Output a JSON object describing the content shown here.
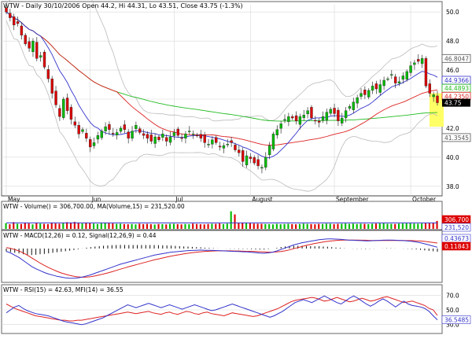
{
  "header": {
    "symbol": "WTW",
    "info": "WTW - Daily 30/10/2006 Open 44.2, Hi 44.31, Lo 43.51, Close 43.75 (-1.3%)"
  },
  "colors": {
    "up": "#00bb00",
    "down": "#dd0000",
    "ma_short": "#3333cc",
    "ma_mid": "#dd2222",
    "ma_long": "#22bb22",
    "bands": "#bbbbbb",
    "grid": "#d8d8d8",
    "highlight": "#ffff66"
  },
  "chart_data": [
    {
      "type": "candlestick",
      "panel": "price",
      "title": "WTW - Daily 30/10/2006 Open 44.2, Hi 44.31, Lo 43.51, Close 43.75 (-1.3%)",
      "y_ticks": [
        38.0,
        40.0,
        42.0,
        44.0,
        46.0,
        48.0,
        50.0
      ],
      "ylim": [
        37.5,
        50.5
      ],
      "x_labels": [
        "May",
        "Jun",
        "Jul",
        "August",
        "September",
        "October"
      ],
      "x_label_index": [
        0,
        22,
        44,
        64,
        86,
        106
      ],
      "closes": [
        50.0,
        49.6,
        49.1,
        49.2,
        48.4,
        47.8,
        47.5,
        48.0,
        46.8,
        47.0,
        46.2,
        45.4,
        44.4,
        43.6,
        42.8,
        44.0,
        43.2,
        42.6,
        42.2,
        41.6,
        41.9,
        41.3,
        40.7,
        41.0,
        41.5,
        41.8,
        42.1,
        41.9,
        41.6,
        41.7,
        42.0,
        41.9,
        41.3,
        41.8,
        42.2,
        41.7,
        41.5,
        41.3,
        41.1,
        41.4,
        41.2,
        41.6,
        41.1,
        41.4,
        41.7,
        41.5,
        41.3,
        41.6,
        41.8,
        41.6,
        41.5,
        41.3,
        41.0,
        40.9,
        41.2,
        41.0,
        40.7,
        40.8,
        40.9,
        41.0,
        40.5,
        40.3,
        39.7,
        40.1,
        39.9,
        39.6,
        39.4,
        39.3,
        40.0,
        40.8,
        41.6,
        41.9,
        42.3,
        42.6,
        42.8,
        42.7,
        42.5,
        42.8,
        42.9,
        43.2,
        42.7,
        42.5,
        42.4,
        42.8,
        43.1,
        43.3,
        43.0,
        42.5,
        42.7,
        43.2,
        43.5,
        43.8,
        44.1,
        44.4,
        44.3,
        44.6,
        44.9,
        44.7,
        45.0,
        45.3,
        45.4,
        45.7,
        45.1,
        45.2,
        45.6,
        45.9,
        46.3,
        46.5,
        46.6,
        46.8,
        44.9,
        44.4,
        44.3,
        43.75
      ],
      "last_close": "43.75",
      "sma_labels": [
        "46.8047",
        "44.9366",
        "44.4893",
        "44.2350",
        "41.3545"
      ],
      "sma_colors": [
        "#555555",
        "#3333cc",
        "#22bb22",
        "#dd2222",
        "#555555"
      ]
    },
    {
      "type": "bar",
      "panel": "volume",
      "label": "WTW - Volume() = 306,700.00, MA(Volume,15) = 231,520.00",
      "value_labels": [
        "306,700",
        "231,520"
      ],
      "volumes": [
        220,
        180,
        260,
        200,
        190,
        230,
        210,
        175,
        240,
        205,
        195,
        185,
        230,
        210,
        200,
        225,
        260,
        245,
        270,
        230,
        210,
        240,
        220,
        205,
        190,
        215,
        240,
        225,
        210,
        195,
        200,
        185,
        180,
        190,
        175,
        200,
        185,
        195,
        180,
        170,
        190,
        185,
        175,
        195,
        200,
        185,
        175,
        190,
        180,
        205,
        190,
        180,
        175,
        190,
        200,
        195,
        210,
        185,
        205,
        680,
        560,
        240,
        235,
        225,
        215,
        205,
        200,
        195,
        190,
        185,
        175,
        195,
        180,
        190,
        200,
        185,
        180,
        190,
        205,
        195,
        185,
        180,
        195,
        190,
        205,
        200,
        185,
        195,
        200,
        210,
        195,
        205,
        190,
        200,
        195,
        185,
        200,
        205,
        210,
        215,
        200,
        195,
        190,
        205,
        210,
        215,
        220,
        205,
        200,
        210,
        215,
        225,
        240,
        306.7
      ],
      "volume_ma": 231.52
    },
    {
      "type": "line",
      "panel": "macd",
      "label": "WTW - MACD(12,26) = 0.12, Signal(12,26,9) = 0.44",
      "value_labels": [
        "0.43673",
        "0.11843"
      ],
      "series": [
        {
          "name": "MACD(12,26)",
          "color": "#3333cc"
        },
        {
          "name": "Signal(12,26,9)",
          "color": "#dd2222"
        }
      ],
      "macd": [
        -0.1,
        -0.18,
        -0.3,
        -0.42,
        -0.58,
        -0.74,
        -0.9,
        -1.02,
        -1.12,
        -1.22,
        -1.3,
        -1.36,
        -1.42,
        -1.46,
        -1.5,
        -1.52,
        -1.52,
        -1.5,
        -1.46,
        -1.4,
        -1.34,
        -1.26,
        -1.18,
        -1.1,
        -1.02,
        -0.94,
        -0.86,
        -0.78,
        -0.72,
        -0.66,
        -0.6,
        -0.54,
        -0.48,
        -0.42,
        -0.36,
        -0.3,
        -0.26,
        -0.22,
        -0.18,
        -0.14,
        -0.12,
        -0.1,
        -0.08,
        -0.06,
        -0.05,
        -0.04,
        -0.03,
        -0.04,
        -0.04,
        -0.05,
        -0.06,
        -0.07,
        -0.08,
        -0.09,
        -0.1,
        -0.11,
        -0.12,
        -0.13,
        -0.15,
        -0.17,
        -0.19,
        -0.2,
        -0.18,
        -0.14,
        -0.08,
        0.0,
        0.08,
        0.16,
        0.24,
        0.3,
        0.36,
        0.4,
        0.44,
        0.48,
        0.52,
        0.54,
        0.56,
        0.56,
        0.55,
        0.54,
        0.52,
        0.5,
        0.49,
        0.48,
        0.47,
        0.46,
        0.46,
        0.47,
        0.48,
        0.49,
        0.5,
        0.5,
        0.49,
        0.48,
        0.47,
        0.45,
        0.43,
        0.4,
        0.36,
        0.3,
        0.24,
        0.18,
        0.12
      ],
      "signal": [
        0.1,
        0.06,
        0.0,
        -0.08,
        -0.18,
        -0.3,
        -0.44,
        -0.58,
        -0.72,
        -0.84,
        -0.96,
        -1.06,
        -1.16,
        -1.24,
        -1.31,
        -1.37,
        -1.42,
        -1.45,
        -1.47,
        -1.46,
        -1.44,
        -1.4,
        -1.35,
        -1.3,
        -1.24,
        -1.18,
        -1.11,
        -1.04,
        -0.98,
        -0.91,
        -0.85,
        -0.79,
        -0.73,
        -0.67,
        -0.61,
        -0.55,
        -0.5,
        -0.45,
        -0.4,
        -0.35,
        -0.31,
        -0.27,
        -0.23,
        -0.2,
        -0.17,
        -0.14,
        -0.12,
        -0.1,
        -0.09,
        -0.08,
        -0.07,
        -0.07,
        -0.07,
        -0.07,
        -0.08,
        -0.08,
        -0.09,
        -0.1,
        -0.1,
        -0.11,
        -0.12,
        -0.13,
        -0.14,
        -0.14,
        -0.13,
        -0.11,
        -0.07,
        -0.02,
        0.04,
        0.1,
        0.16,
        0.22,
        0.27,
        0.32,
        0.36,
        0.4,
        0.43,
        0.46,
        0.48,
        0.49,
        0.5,
        0.5,
        0.5,
        0.5,
        0.49,
        0.49,
        0.48,
        0.48,
        0.48,
        0.48,
        0.48,
        0.48,
        0.48,
        0.48,
        0.48,
        0.47,
        0.47,
        0.46,
        0.45,
        0.43,
        0.4,
        0.37,
        0.34
      ]
    },
    {
      "type": "line",
      "panel": "rsi",
      "label": "WTW - RSI(15) = 42.63, MFI(14) = 36.55",
      "y_ticks": [
        30.0,
        50.0,
        70.0
      ],
      "ylim": [
        20,
        80
      ],
      "value_labels": [
        "36.5485"
      ],
      "series": [
        {
          "name": "RSI(15)",
          "color": "#dd2222"
        },
        {
          "name": "MFI(14)",
          "color": "#3333cc"
        }
      ],
      "rsi": [
        58,
        55,
        52,
        50,
        48,
        46,
        44,
        42,
        41,
        40,
        39,
        38,
        37,
        36,
        36,
        35,
        35,
        36,
        36,
        37,
        38,
        39,
        40,
        41,
        42,
        43,
        44,
        45,
        46,
        47,
        46,
        45,
        46,
        47,
        48,
        46,
        45,
        44,
        46,
        47,
        45,
        44,
        46,
        48,
        47,
        45,
        44,
        46,
        47,
        45,
        44,
        43,
        42,
        44,
        46,
        45,
        44,
        43,
        42,
        41,
        42,
        44,
        46,
        48,
        50,
        52,
        55,
        58,
        61,
        63,
        64,
        65,
        66,
        67,
        66,
        64,
        62,
        63,
        65,
        67,
        65,
        63,
        61,
        62,
        64,
        66,
        64,
        62,
        63,
        65,
        67,
        68,
        66,
        64,
        62,
        60,
        61,
        62,
        60,
        58,
        56,
        52,
        50,
        42.63
      ],
      "mfi": [
        46,
        50,
        54,
        56,
        52,
        49,
        47,
        45,
        44,
        43,
        42,
        40,
        38,
        36,
        34,
        33,
        32,
        31,
        30,
        31,
        33,
        35,
        37,
        39,
        42,
        45,
        48,
        51,
        54,
        57,
        55,
        53,
        55,
        57,
        59,
        57,
        55,
        53,
        55,
        57,
        55,
        53,
        51,
        53,
        55,
        57,
        55,
        53,
        51,
        49,
        50,
        52,
        54,
        56,
        58,
        56,
        54,
        52,
        50,
        48,
        46,
        44,
        42,
        40,
        42,
        45,
        48,
        52,
        56,
        60,
        62,
        64,
        62,
        60,
        63,
        66,
        69,
        66,
        63,
        60,
        58,
        62,
        66,
        69,
        66,
        62,
        58,
        55,
        58,
        62,
        65,
        62,
        58,
        54,
        58,
        62,
        58,
        56,
        55,
        54,
        52,
        48,
        42,
        36.55
      ]
    }
  ]
}
